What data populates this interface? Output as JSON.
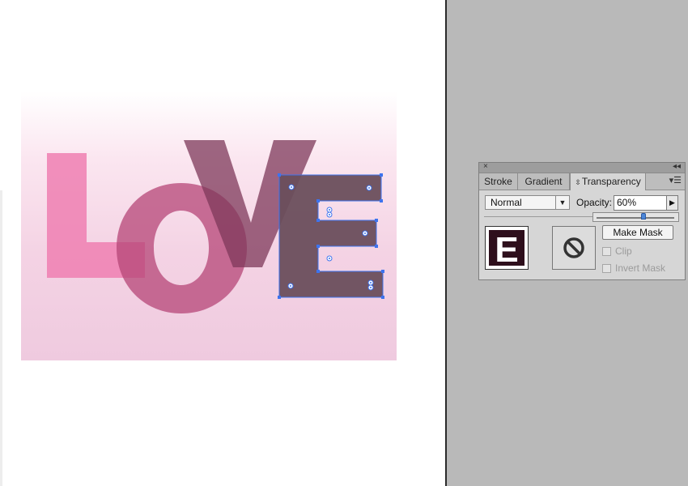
{
  "artwork": {
    "letters": [
      "L",
      "o",
      "V",
      "E"
    ],
    "colors": {
      "L": "#ee7fb2",
      "o": "#b64677",
      "V": "#7d3859",
      "E": "#6a4e5c",
      "selection": "#3d73ee"
    }
  },
  "panel": {
    "close_icon": "×",
    "collapse_icon": "◂◂",
    "menu_icon": "▾☰",
    "tabs": {
      "stroke": "Stroke",
      "gradient": "Gradient",
      "transparency_arrows": "⇳",
      "transparency": "Transparency"
    },
    "blend_mode": "Normal",
    "blend_arrow": "▼",
    "opacity_label": "Opacity:",
    "opacity_value": "60%",
    "opacity_arrow": "▶",
    "opacity_slider_fraction": 0.6,
    "thumbnail_letter": "E",
    "make_mask": "Make Mask",
    "clip": "Clip",
    "invert_mask": "Invert Mask"
  }
}
